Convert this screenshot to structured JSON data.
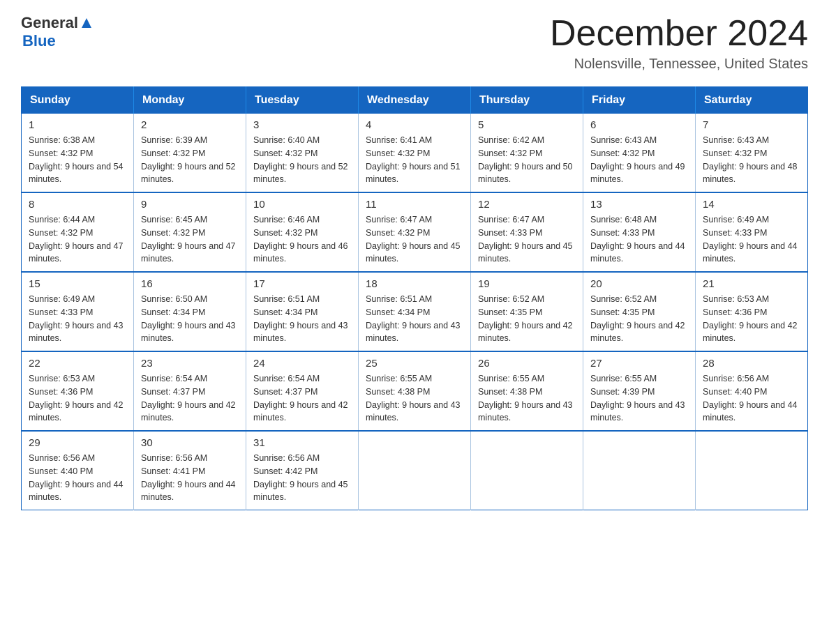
{
  "logo": {
    "text_general": "General",
    "arrow_symbol": "▶",
    "text_blue": "Blue"
  },
  "header": {
    "title": "December 2024",
    "subtitle": "Nolensville, Tennessee, United States"
  },
  "calendar": {
    "days_of_week": [
      "Sunday",
      "Monday",
      "Tuesday",
      "Wednesday",
      "Thursday",
      "Friday",
      "Saturday"
    ],
    "weeks": [
      [
        {
          "day": "1",
          "sunrise": "6:38 AM",
          "sunset": "4:32 PM",
          "daylight": "9 hours and 54 minutes."
        },
        {
          "day": "2",
          "sunrise": "6:39 AM",
          "sunset": "4:32 PM",
          "daylight": "9 hours and 52 minutes."
        },
        {
          "day": "3",
          "sunrise": "6:40 AM",
          "sunset": "4:32 PM",
          "daylight": "9 hours and 52 minutes."
        },
        {
          "day": "4",
          "sunrise": "6:41 AM",
          "sunset": "4:32 PM",
          "daylight": "9 hours and 51 minutes."
        },
        {
          "day": "5",
          "sunrise": "6:42 AM",
          "sunset": "4:32 PM",
          "daylight": "9 hours and 50 minutes."
        },
        {
          "day": "6",
          "sunrise": "6:43 AM",
          "sunset": "4:32 PM",
          "daylight": "9 hours and 49 minutes."
        },
        {
          "day": "7",
          "sunrise": "6:43 AM",
          "sunset": "4:32 PM",
          "daylight": "9 hours and 48 minutes."
        }
      ],
      [
        {
          "day": "8",
          "sunrise": "6:44 AM",
          "sunset": "4:32 PM",
          "daylight": "9 hours and 47 minutes."
        },
        {
          "day": "9",
          "sunrise": "6:45 AM",
          "sunset": "4:32 PM",
          "daylight": "9 hours and 47 minutes."
        },
        {
          "day": "10",
          "sunrise": "6:46 AM",
          "sunset": "4:32 PM",
          "daylight": "9 hours and 46 minutes."
        },
        {
          "day": "11",
          "sunrise": "6:47 AM",
          "sunset": "4:32 PM",
          "daylight": "9 hours and 45 minutes."
        },
        {
          "day": "12",
          "sunrise": "6:47 AM",
          "sunset": "4:33 PM",
          "daylight": "9 hours and 45 minutes."
        },
        {
          "day": "13",
          "sunrise": "6:48 AM",
          "sunset": "4:33 PM",
          "daylight": "9 hours and 44 minutes."
        },
        {
          "day": "14",
          "sunrise": "6:49 AM",
          "sunset": "4:33 PM",
          "daylight": "9 hours and 44 minutes."
        }
      ],
      [
        {
          "day": "15",
          "sunrise": "6:49 AM",
          "sunset": "4:33 PM",
          "daylight": "9 hours and 43 minutes."
        },
        {
          "day": "16",
          "sunrise": "6:50 AM",
          "sunset": "4:34 PM",
          "daylight": "9 hours and 43 minutes."
        },
        {
          "day": "17",
          "sunrise": "6:51 AM",
          "sunset": "4:34 PM",
          "daylight": "9 hours and 43 minutes."
        },
        {
          "day": "18",
          "sunrise": "6:51 AM",
          "sunset": "4:34 PM",
          "daylight": "9 hours and 43 minutes."
        },
        {
          "day": "19",
          "sunrise": "6:52 AM",
          "sunset": "4:35 PM",
          "daylight": "9 hours and 42 minutes."
        },
        {
          "day": "20",
          "sunrise": "6:52 AM",
          "sunset": "4:35 PM",
          "daylight": "9 hours and 42 minutes."
        },
        {
          "day": "21",
          "sunrise": "6:53 AM",
          "sunset": "4:36 PM",
          "daylight": "9 hours and 42 minutes."
        }
      ],
      [
        {
          "day": "22",
          "sunrise": "6:53 AM",
          "sunset": "4:36 PM",
          "daylight": "9 hours and 42 minutes."
        },
        {
          "day": "23",
          "sunrise": "6:54 AM",
          "sunset": "4:37 PM",
          "daylight": "9 hours and 42 minutes."
        },
        {
          "day": "24",
          "sunrise": "6:54 AM",
          "sunset": "4:37 PM",
          "daylight": "9 hours and 42 minutes."
        },
        {
          "day": "25",
          "sunrise": "6:55 AM",
          "sunset": "4:38 PM",
          "daylight": "9 hours and 43 minutes."
        },
        {
          "day": "26",
          "sunrise": "6:55 AM",
          "sunset": "4:38 PM",
          "daylight": "9 hours and 43 minutes."
        },
        {
          "day": "27",
          "sunrise": "6:55 AM",
          "sunset": "4:39 PM",
          "daylight": "9 hours and 43 minutes."
        },
        {
          "day": "28",
          "sunrise": "6:56 AM",
          "sunset": "4:40 PM",
          "daylight": "9 hours and 44 minutes."
        }
      ],
      [
        {
          "day": "29",
          "sunrise": "6:56 AM",
          "sunset": "4:40 PM",
          "daylight": "9 hours and 44 minutes."
        },
        {
          "day": "30",
          "sunrise": "6:56 AM",
          "sunset": "4:41 PM",
          "daylight": "9 hours and 44 minutes."
        },
        {
          "day": "31",
          "sunrise": "6:56 AM",
          "sunset": "4:42 PM",
          "daylight": "9 hours and 45 minutes."
        },
        null,
        null,
        null,
        null
      ]
    ]
  }
}
